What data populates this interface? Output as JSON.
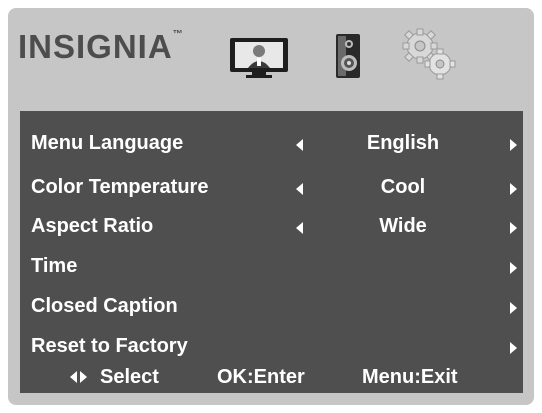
{
  "header": {
    "brand": "INSIGNIA",
    "brand_mark": "™",
    "icons": [
      "tv-picture-icon",
      "speaker-icon",
      "gears-settings-icon"
    ]
  },
  "menu": {
    "items": [
      {
        "label": "Menu Language",
        "value": "English",
        "has_left_arrow": true,
        "has_right_arrow": true
      },
      {
        "label": "Color Temperature",
        "value": "Cool",
        "has_left_arrow": true,
        "has_right_arrow": true
      },
      {
        "label": "Aspect Ratio",
        "value": "Wide",
        "has_left_arrow": true,
        "has_right_arrow": true
      },
      {
        "label": "Time",
        "value": "",
        "has_left_arrow": false,
        "has_right_arrow": true
      },
      {
        "label": "Closed Caption",
        "value": "",
        "has_left_arrow": false,
        "has_right_arrow": true
      },
      {
        "label": "Reset to Factory",
        "value": "",
        "has_left_arrow": false,
        "has_right_arrow": true
      }
    ]
  },
  "footer": {
    "select": "Select",
    "ok": "OK:Enter",
    "menu": "Menu:Exit"
  },
  "colors": {
    "panel_bg": "#c6c6c6",
    "menu_bg": "#4f4f4f",
    "text": "#ffffff",
    "logo": "#4d4d4d"
  }
}
